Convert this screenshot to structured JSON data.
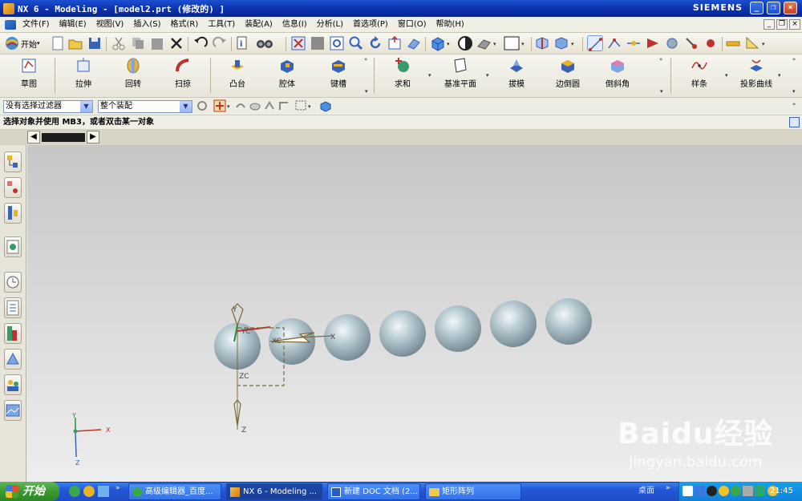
{
  "window": {
    "title": "NX 6 - Modeling - [model2.prt (修改的) ]",
    "brand": "SIEMENS",
    "minimize": "_",
    "restore": "❐",
    "close": "×"
  },
  "menu": {
    "items": [
      "文件(F)",
      "编辑(E)",
      "视图(V)",
      "插入(S)",
      "格式(R)",
      "工具(T)",
      "装配(A)",
      "信息(I)",
      "分析(L)",
      "首选项(P)",
      "窗口(O)",
      "帮助(H)"
    ]
  },
  "toolbar": {
    "start_label": "开始"
  },
  "features": {
    "items": [
      "草图",
      "拉伸",
      "回转",
      "扫掠",
      "凸台",
      "腔体",
      "键槽",
      "求和",
      "基准平面",
      "拔模",
      "边倒圆",
      "倒斜角",
      "样条",
      "投影曲线"
    ]
  },
  "filterbar": {
    "filter_value": "没有选择过滤器",
    "scope_value": "整个装配"
  },
  "status": {
    "prompt": "选择对象并使用 MB3，或者双击某一对象"
  },
  "viewport": {
    "spheres": 7,
    "wcs_labels": {
      "y": "Y",
      "yc": "YC",
      "x": "X",
      "xc": "XC",
      "zc": "ZC",
      "z": "Z"
    },
    "triad_labels": {
      "y": "Y",
      "x": "X",
      "z": "Z"
    }
  },
  "watermark": {
    "logo": "Baidu经验",
    "url": "jingyan.baidu.com"
  },
  "taskbar": {
    "start": "开始",
    "tasks": [
      "高级编辑器_百度...",
      "NX 6 - Modeling ...",
      "新建 DOC 文档 (2...",
      "矩形阵列"
    ],
    "desktop": "桌面",
    "clock": "21:45"
  },
  "colors": {
    "titlebar": "#0a2fa8",
    "sphere": "#a9bcc6",
    "wcs": "#7a6a3a",
    "taskbar": "#2456d6",
    "start": "#3a9a2f"
  }
}
